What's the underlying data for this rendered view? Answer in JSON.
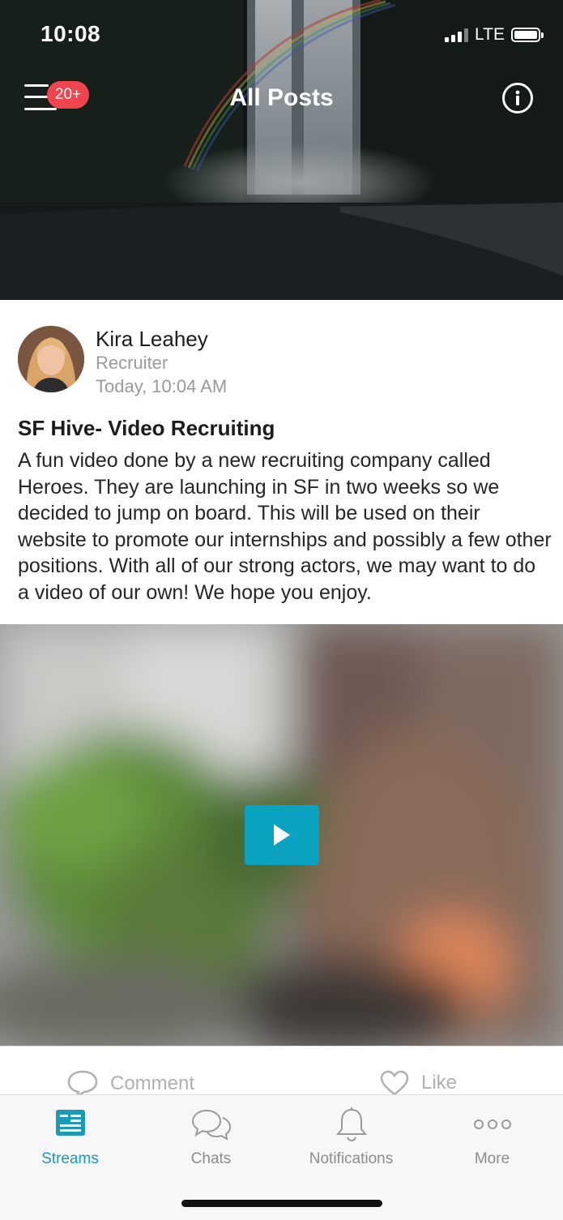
{
  "status_bar": {
    "time": "10:08",
    "network": "LTE"
  },
  "header": {
    "title": "All Posts",
    "menu_badge": "20+",
    "colors": {
      "badge": "#f0454f"
    }
  },
  "post": {
    "author": {
      "name": "Kira Leahey",
      "role": "Recruiter"
    },
    "timestamp": "Today, 10:04 AM",
    "title": "SF Hive- Video Recruiting",
    "body": "A fun video done by a new recruiting company called Heroes.  They are launching in SF in two weeks so we decided to jump on board.  This will be used on their website to promote our internships and possibly a few other positions.  With all of our strong actors,  we may want to do a video of our own!  We hope you enjoy.",
    "actions": {
      "comment": "Comment",
      "like": "Like"
    },
    "colors": {
      "play_button": "#0ba2c2"
    }
  },
  "tabbar": {
    "tabs": [
      {
        "label": "Streams",
        "icon": "streams-icon",
        "active": true
      },
      {
        "label": "Chats",
        "icon": "chat-bubbles-icon",
        "active": false
      },
      {
        "label": "Notifications",
        "icon": "bell-icon",
        "active": false
      },
      {
        "label": "More",
        "icon": "more-dots-icon",
        "active": false
      }
    ],
    "colors": {
      "active": "#1b9ab5",
      "inactive": "#8c8c8c"
    }
  }
}
